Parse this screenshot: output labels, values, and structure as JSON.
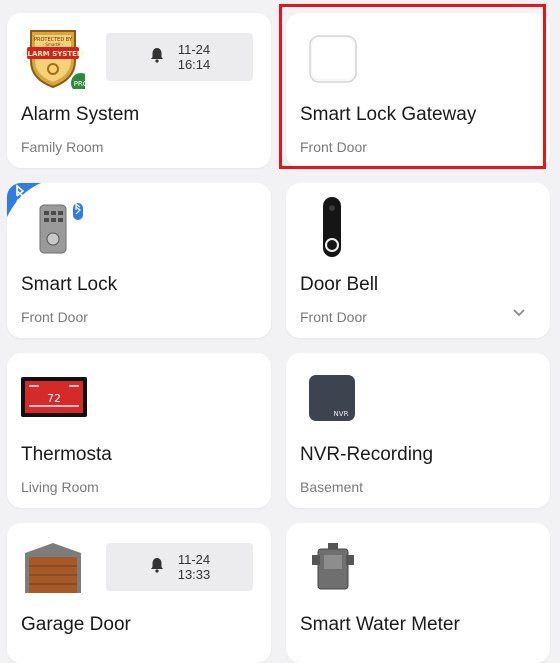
{
  "devices": [
    {
      "name": "Alarm System",
      "room": "Family Room",
      "icon": "alarm-system-icon",
      "alert": {
        "date": "11-24",
        "time": "16:14"
      }
    },
    {
      "name": "Smart Lock Gateway",
      "room": "Front Door",
      "icon": "gateway-icon"
    },
    {
      "name": "Smart Lock",
      "room": "Front Door",
      "icon": "smart-lock-icon"
    },
    {
      "name": "Door Bell",
      "room": "Front Door",
      "icon": "doorbell-icon"
    },
    {
      "name": "Thermosta",
      "room": "Living Room",
      "icon": "thermostat-icon"
    },
    {
      "name": "NVR-Recording",
      "room": "Basement",
      "icon": "nvr-icon",
      "icon_label": "NVR"
    },
    {
      "name": "Garage Door",
      "icon": "garage-door-icon",
      "alert": {
        "date": "11-24",
        "time": "13:33"
      }
    },
    {
      "name": "Smart Water Meter",
      "icon": "water-meter-icon"
    }
  ],
  "alarm_badge": {
    "top": "PROTECTED BY",
    "sub": "- SmartH -",
    "main": "ALARM SYSTEM",
    "pro": "PRO"
  },
  "thermostat_display": "72",
  "colors": {
    "highlight": "#e8141b",
    "bluetooth": "#2f7de1",
    "background": "#f2f2f4"
  }
}
